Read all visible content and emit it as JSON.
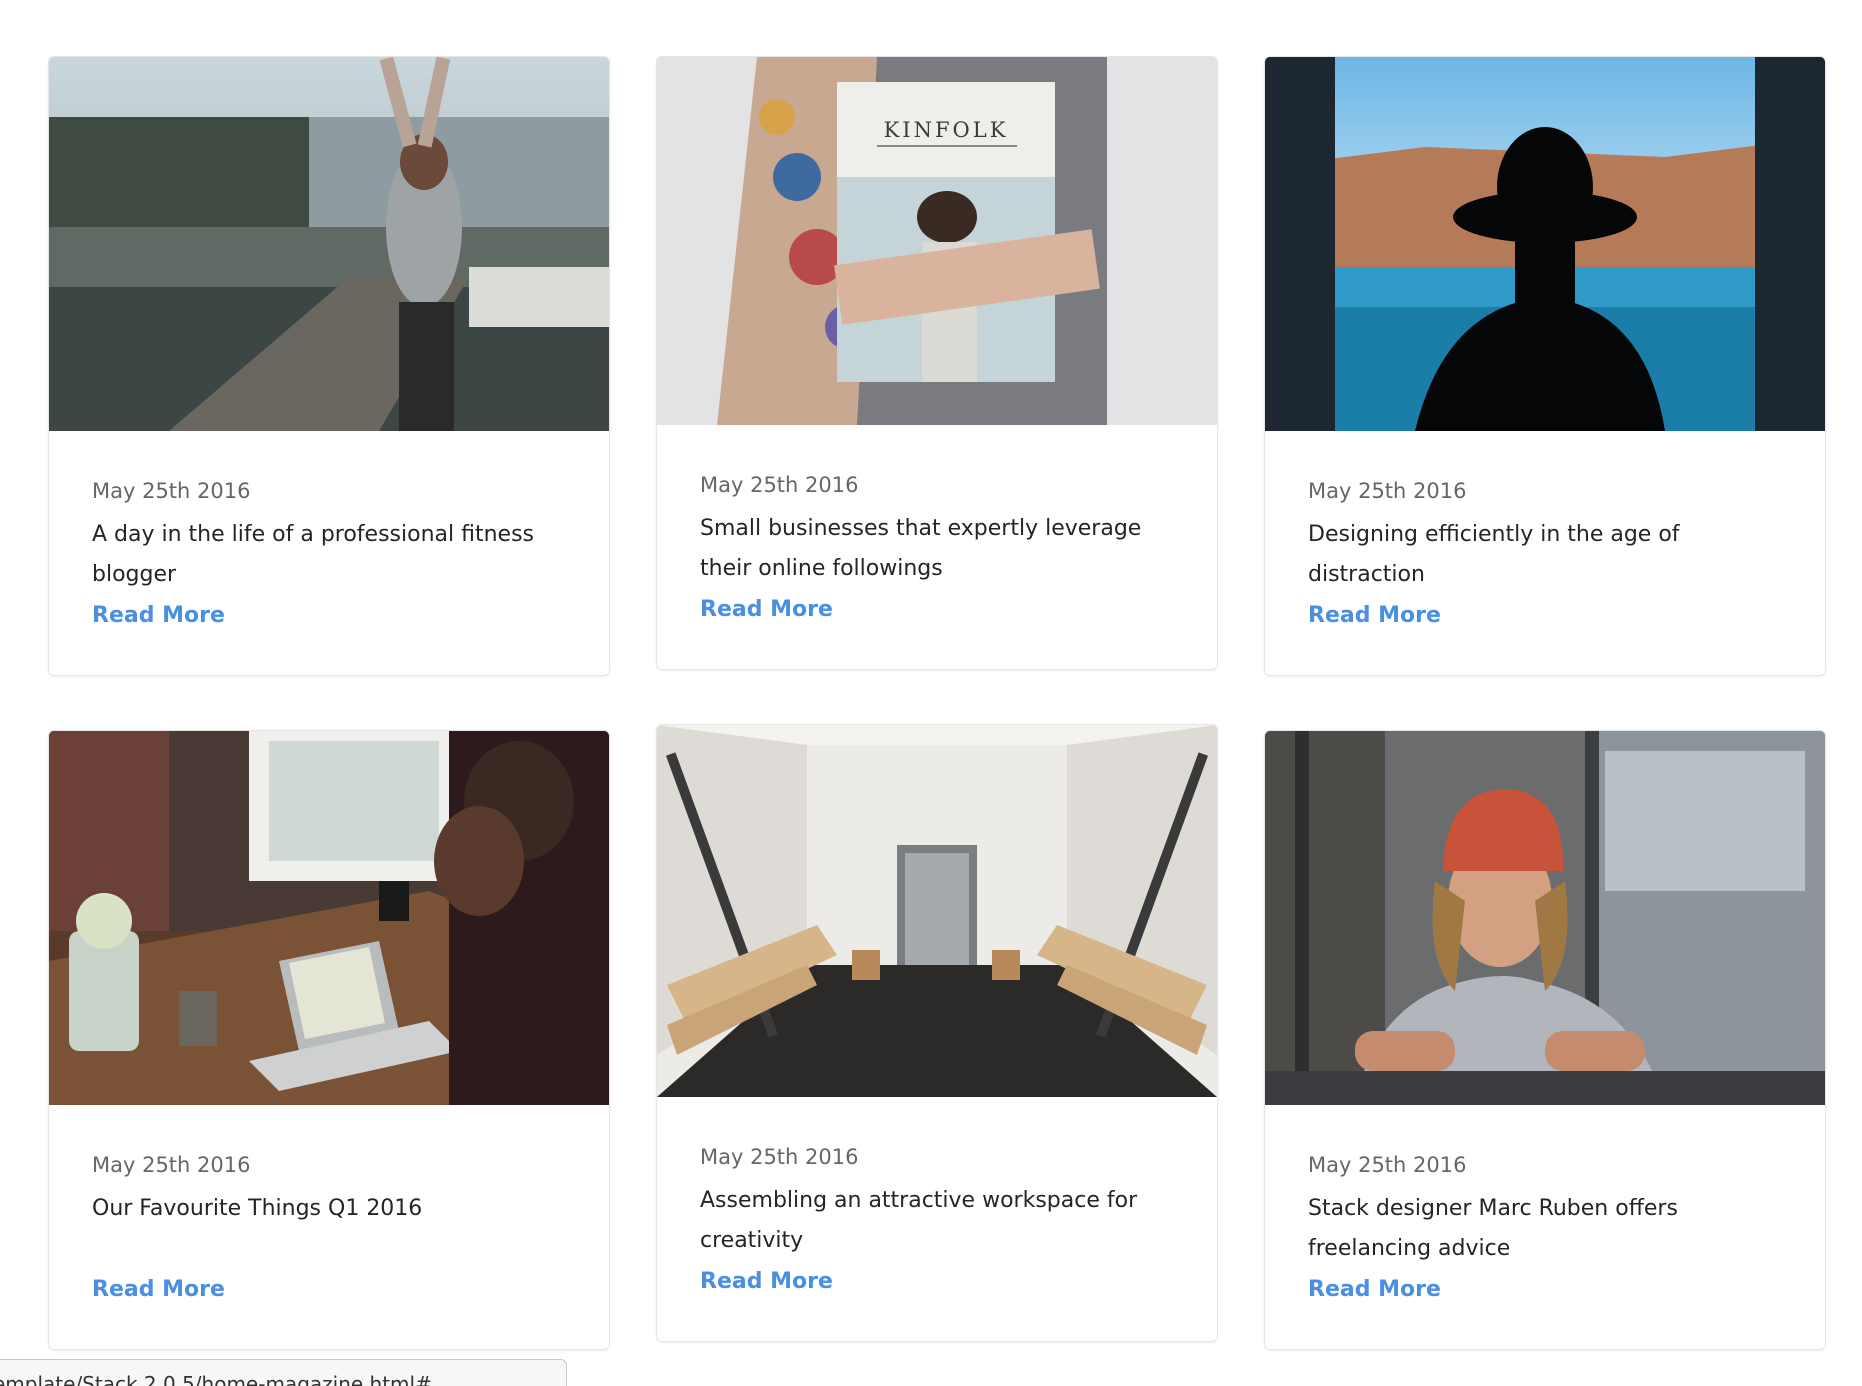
{
  "accent_color": "#4a90e2",
  "posts": [
    {
      "date": "May 25th 2016",
      "title": "A day in the life of a professional fitness blogger",
      "link": "Read More",
      "image": "fitness-woman-stretching-on-dock-photo"
    },
    {
      "date": "May 25th 2016",
      "title": "Small businesses that expertly leverage their online followings",
      "link": "Read More",
      "image": "tattooed-arms-holding-kinfolk-magazine-photo",
      "image_text": "KINFOLK"
    },
    {
      "date": "May 25th 2016",
      "title": "Designing efficiently in the age of distraction",
      "link": "Read More",
      "image": "silhouette-woman-hat-window-photo"
    },
    {
      "date": "May 25th 2016",
      "title": "Our Favourite Things Q1 2016",
      "link": "Read More",
      "image": "man-working-on-laptop-photo"
    },
    {
      "date": "May 25th 2016",
      "title": "Assembling an attractive workspace for creativity",
      "link": "Read More",
      "image": "bright-shop-interior-photo"
    },
    {
      "date": "May 25th 2016",
      "title": "Stack designer Marc Ruben offers freelancing advice",
      "link": "Read More",
      "image": "man-in-beanie-at-window-photo"
    }
  ],
  "status_bar": {
    "url": "emplate/Stack 2.0.5/home-magazine.html#"
  }
}
